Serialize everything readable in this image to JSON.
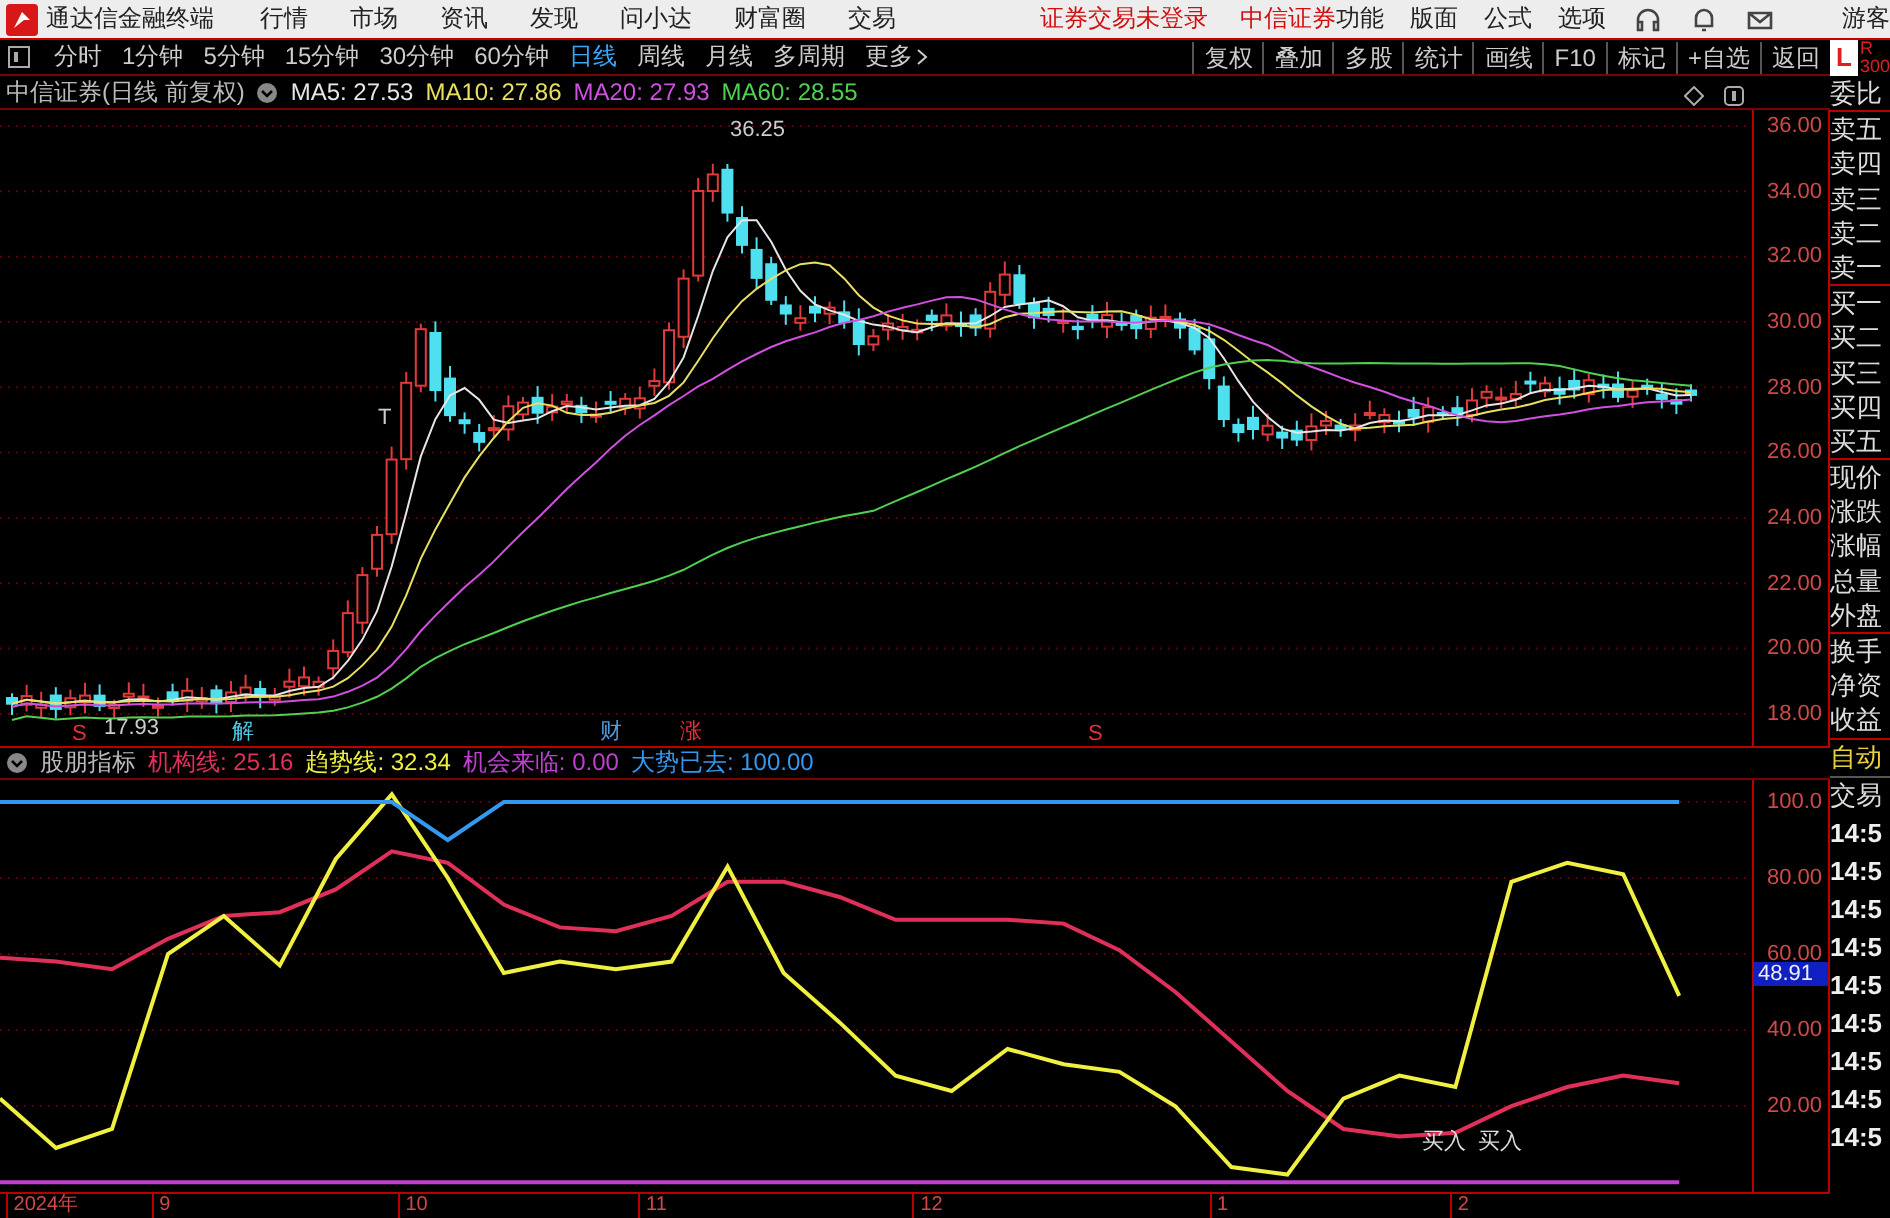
{
  "top_bar": {
    "app_title": "通达信金融终端",
    "menu": [
      "行情",
      "市场",
      "资讯",
      "发现",
      "问小达",
      "财富圈",
      "交易"
    ],
    "login_status": "证券交易未登录",
    "broker": "中信证券",
    "right_menu": [
      "功能",
      "版面",
      "公式",
      "选项"
    ],
    "user": "游客"
  },
  "toolbar": {
    "periods": [
      {
        "label": "分时",
        "selected": false
      },
      {
        "label": "1分钟",
        "selected": false
      },
      {
        "label": "5分钟",
        "selected": false
      },
      {
        "label": "15分钟",
        "selected": false
      },
      {
        "label": "30分钟",
        "selected": false
      },
      {
        "label": "60分钟",
        "selected": false
      },
      {
        "label": "日线",
        "selected": true
      },
      {
        "label": "周线",
        "selected": false
      },
      {
        "label": "月线",
        "selected": false
      },
      {
        "label": "多周期",
        "selected": false
      }
    ],
    "more": "更多",
    "tools": [
      "复权",
      "叠加",
      "多股",
      "统计",
      "画线",
      "F10",
      "标记",
      "+自选",
      "返回"
    ]
  },
  "price_panel": {
    "title": "中信证券(日线 前复权)",
    "legend": [
      {
        "label": "MA5: 27.53",
        "color": "#e6e6e6"
      },
      {
        "label": "MA10: 27.86",
        "color": "#e8e060"
      },
      {
        "label": "MA20: 27.93",
        "color": "#d050e0"
      },
      {
        "label": "MA60: 28.55",
        "color": "#50d050"
      }
    ],
    "y_axis": [
      "36.00",
      "34.00",
      "32.00",
      "30.00",
      "28.00",
      "26.00",
      "24.00",
      "22.00",
      "20.00",
      "18.00"
    ],
    "annotations": [
      "36.25",
      "17.93",
      "T"
    ],
    "events": [
      {
        "text": "S",
        "color": "#e0303a"
      },
      {
        "text": "解",
        "color": "#4ec9e0"
      },
      {
        "text": "财",
        "color": "#4e9be0"
      },
      {
        "text": "涨",
        "color": "#e0303a"
      },
      {
        "text": "S",
        "color": "#e0303a"
      }
    ]
  },
  "indicator_panel": {
    "title": "股朋指标",
    "legend_values": [
      ": 25.16",
      ": 32.34",
      ": 0.00",
      ": 100.00"
    ],
    "cursor_reading": "48.91",
    "x_axis": [
      "2024年",
      "9",
      "10",
      "11",
      "12",
      "1",
      "2"
    ],
    "chart_data": {
      "type": "line",
      "grid": true,
      "categories": [
        null,
        null,
        null,
        null,
        null,
        null,
        null,
        null,
        null,
        null,
        null,
        null,
        null,
        null,
        null,
        null,
        null,
        null,
        null,
        null,
        null,
        null,
        null,
        null,
        null,
        null,
        null,
        null,
        null,
        null,
        null
      ],
      "ylim": [
        -2.6,
        105.8
      ],
      "yticks": [
        {
          "value": 100,
          "label": "100.0"
        },
        {
          "value": 80,
          "label": "80.00"
        },
        {
          "value": 60,
          "label": "60.00"
        },
        {
          "value": 40,
          "label": "40.00"
        },
        {
          "value": 20,
          "label": "20.00"
        }
      ],
      "series": [
        {
          "name": "机构线",
          "color": "#e0305a",
          "values": [
            59,
            58,
            56,
            64,
            70,
            71,
            77,
            87,
            84,
            73,
            67,
            66,
            70,
            79,
            79,
            75,
            69,
            69,
            69,
            68,
            61,
            50,
            37,
            24,
            14,
            12,
            13,
            20,
            25,
            28,
            26
          ]
        },
        {
          "name": "趋势线",
          "color": "#f0f040",
          "values": [
            22,
            9,
            14,
            60,
            70,
            57,
            85,
            102,
            80,
            55,
            58,
            56,
            58,
            83,
            55,
            42,
            28,
            24,
            35,
            31,
            29,
            20,
            4,
            2,
            22,
            28,
            25,
            79,
            84,
            81,
            49
          ]
        },
        {
          "name": "机会来临",
          "color": "#c040d0",
          "values": [
            0,
            0,
            0,
            0,
            0,
            0,
            0,
            0,
            0,
            0,
            0,
            0,
            0,
            0,
            0,
            0,
            0,
            0,
            0,
            0,
            0,
            0,
            0,
            0,
            0,
            0,
            0,
            0,
            0,
            0,
            0
          ]
        },
        {
          "name": "大势已去",
          "color": "#3399ee",
          "values": [
            100,
            100,
            100,
            100,
            100,
            100,
            100,
            100,
            90,
            100,
            100,
            100,
            100,
            100,
            100,
            100,
            100,
            100,
            100,
            100,
            100,
            100,
            100,
            100,
            100,
            100,
            100,
            100,
            100,
            100,
            100
          ]
        }
      ],
      "annotations": [
        {
          "text": "买入"
        },
        {
          "text": "买入"
        }
      ]
    }
  },
  "side_panel": {
    "left": "L",
    "right": "R",
    "right_sub": "300",
    "quote_groups": [
      [
        "委比"
      ],
      [
        "卖五",
        "卖四",
        "卖三",
        "卖二",
        "卖一"
      ],
      [
        "买一",
        "买二",
        "买三",
        "买四",
        "买五"
      ],
      [
        "现价",
        "涨跌",
        "涨幅",
        "总量",
        "外盘"
      ],
      [
        "换手",
        "净资",
        "收益"
      ]
    ],
    "auto_label": "自动",
    "trade_label": "交易",
    "times": [
      "14:5",
      "14:5",
      "14:5",
      "14:5",
      "14:5",
      "14:5",
      "14:5",
      "14:5",
      "14:5"
    ]
  }
}
